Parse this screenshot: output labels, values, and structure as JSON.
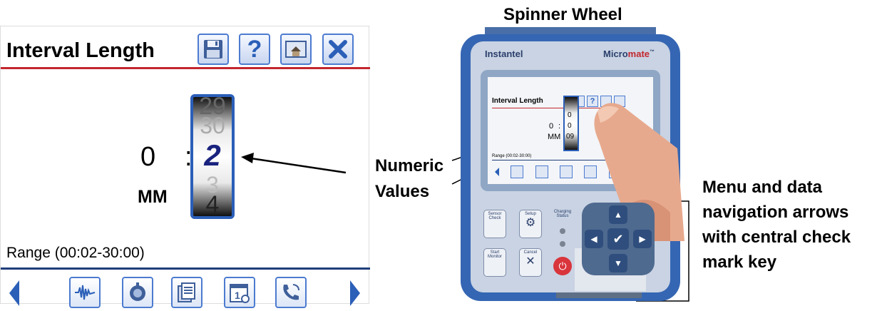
{
  "left_screen": {
    "title": "Interval Length",
    "toolbar_icons": [
      "save-icon",
      "help-icon",
      "home-icon",
      "close-icon"
    ],
    "help_glyph": "?",
    "minutes_value": "0",
    "separator": ":",
    "unit_label": "MM",
    "spinner_values": [
      "29",
      "30",
      "2",
      "3",
      "4"
    ],
    "range_text": "Range (00:02-30:00)",
    "nav_icons": [
      "left-arrow-icon",
      "waveform-icon",
      "geophone-icon",
      "files-icon",
      "calendar-icon",
      "phone-icon",
      "right-arrow-icon"
    ],
    "colors": {
      "title_rule": "#c3262e",
      "nav_rule": "#1f3d7a",
      "accent": "#2b5fb8",
      "selected_value": "#1a237e"
    }
  },
  "callouts": {
    "spinner_wheel": "Spinner Wheel",
    "numeric_values_line1": "Numeric",
    "numeric_values_line2": "Values",
    "menu_line1": "Menu and data",
    "menu_line2": "navigation arrows",
    "menu_line3": "with central check",
    "menu_line4": "mark key"
  },
  "device": {
    "brand": "Instantel",
    "model_prefix": "Micro",
    "model_suffix": "mate",
    "trademark": "™",
    "screen_title": "Interval Length",
    "screen_help": "?",
    "screen_zero": "0",
    "screen_colon": ":",
    "screen_mm": "MM",
    "spinner_values": [
      "0",
      "0",
      "09"
    ],
    "range_text": "Range (00:02-30:00)",
    "buttons": {
      "sensor_check": "Sensor Check",
      "setup": "Setup",
      "charging_status": "Charging Status",
      "start_monitor": "Start Monitor",
      "cancel": "Cancel"
    }
  }
}
